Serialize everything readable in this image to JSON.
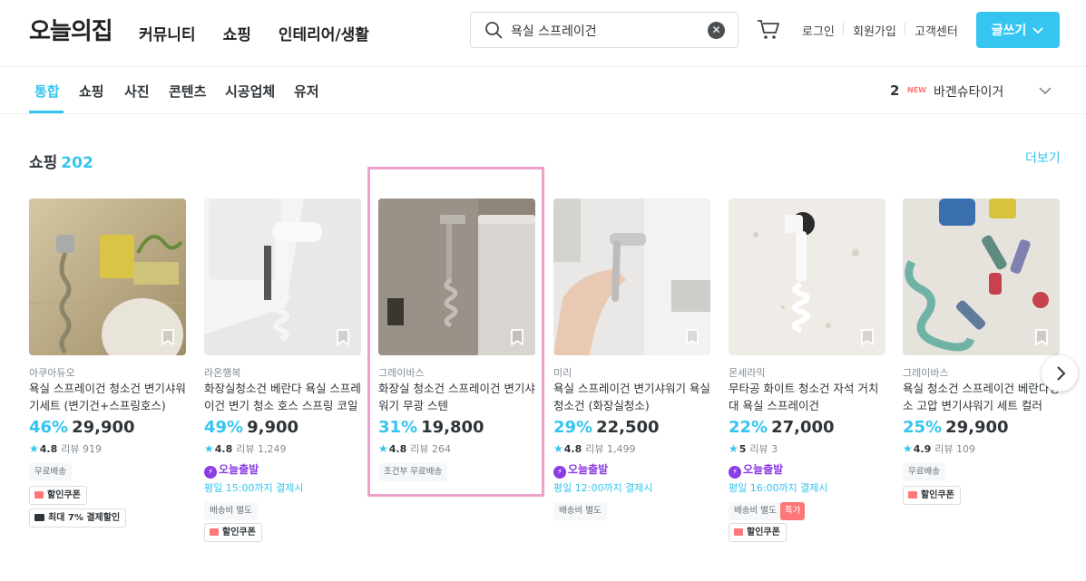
{
  "header": {
    "logo": "오늘의집",
    "nav": [
      "커뮤니티",
      "쇼핑",
      "인테리어/생활"
    ],
    "search": {
      "value": "욕실 스프레이건",
      "icon": "search-icon",
      "clear_icon": "clear-icon"
    },
    "login": "로그인",
    "signup": "회원가입",
    "support": "고객센터",
    "write_button": "글쓰기"
  },
  "tabs": {
    "items": [
      "통합",
      "쇼핑",
      "사진",
      "콘텐츠",
      "시공업체",
      "유저"
    ],
    "active": "통합"
  },
  "ranking": {
    "rank": "2",
    "badge": "NEW",
    "keyword": "바겐슈타이거"
  },
  "section": {
    "title": "쇼핑",
    "count": "202",
    "more": "더보기"
  },
  "products": [
    {
      "brand": "아쿠아듀오",
      "name": "욕실 스프레이건 청소건 변기샤워기세트 (변기건+스프링호스)",
      "discount": "46%",
      "price": "29,900",
      "rating": "4.8",
      "reviews": "리뷰 919",
      "tags": [
        "무료배송"
      ],
      "coupons": [
        "할인쿠폰",
        "최대 7% 결제할인"
      ]
    },
    {
      "brand": "라온행복",
      "name": "화장실청소건 베란다 욕실 스프레이건 변기 청소 호스 스프링 코일 ...",
      "discount": "49%",
      "price": "9,900",
      "rating": "4.8",
      "reviews": "리뷰 1,249",
      "today": "오늘출발",
      "ship_time": "평일 15:00까지 결제시",
      "tags": [
        "배송비 별도"
      ],
      "coupons": [
        "할인쿠폰"
      ]
    },
    {
      "brand": "그레이바스",
      "name": "화장실 청소건 스프레이건 변기샤워기 무광 스텐",
      "discount": "31%",
      "price": "19,800",
      "rating": "4.8",
      "reviews": "리뷰 264",
      "tags": [
        "조건부 무료배송"
      ],
      "coupons": []
    },
    {
      "brand": "미리",
      "name": "욕실 스프레이건 변기샤워기 욕실청소건 (화장실청소)",
      "discount": "29%",
      "price": "22,500",
      "rating": "4.8",
      "reviews": "리뷰 1,499",
      "today": "오늘출발",
      "ship_time": "평일 12:00까지 결제시",
      "tags": [
        "배송비 별도"
      ],
      "coupons": []
    },
    {
      "brand": "몬세라믹",
      "name": "무타공 화이트 청소건 자석 거치대 욕실 스프레이건",
      "discount": "22%",
      "price": "27,000",
      "rating": "5",
      "reviews": "리뷰 3",
      "today": "오늘출발",
      "ship_time": "평일 16:00까지 결제시",
      "tags": [
        "배송비 별도"
      ],
      "special": "특가",
      "coupons": [
        "할인쿠폰"
      ]
    },
    {
      "brand": "그레이바스",
      "name": "욕실 청소건 스프레이건 베란다청소 고압 변기샤워기 세트 컬러",
      "discount": "25%",
      "price": "29,900",
      "rating": "4.9",
      "reviews": "리뷰 109",
      "tags": [
        "무료배송"
      ],
      "coupons": [
        "할인쿠폰"
      ]
    }
  ],
  "colors": {
    "accent": "#35c5f0",
    "highlight": "#eba2cb",
    "today": "#8c3ce6",
    "coupon": "#ff7777"
  }
}
